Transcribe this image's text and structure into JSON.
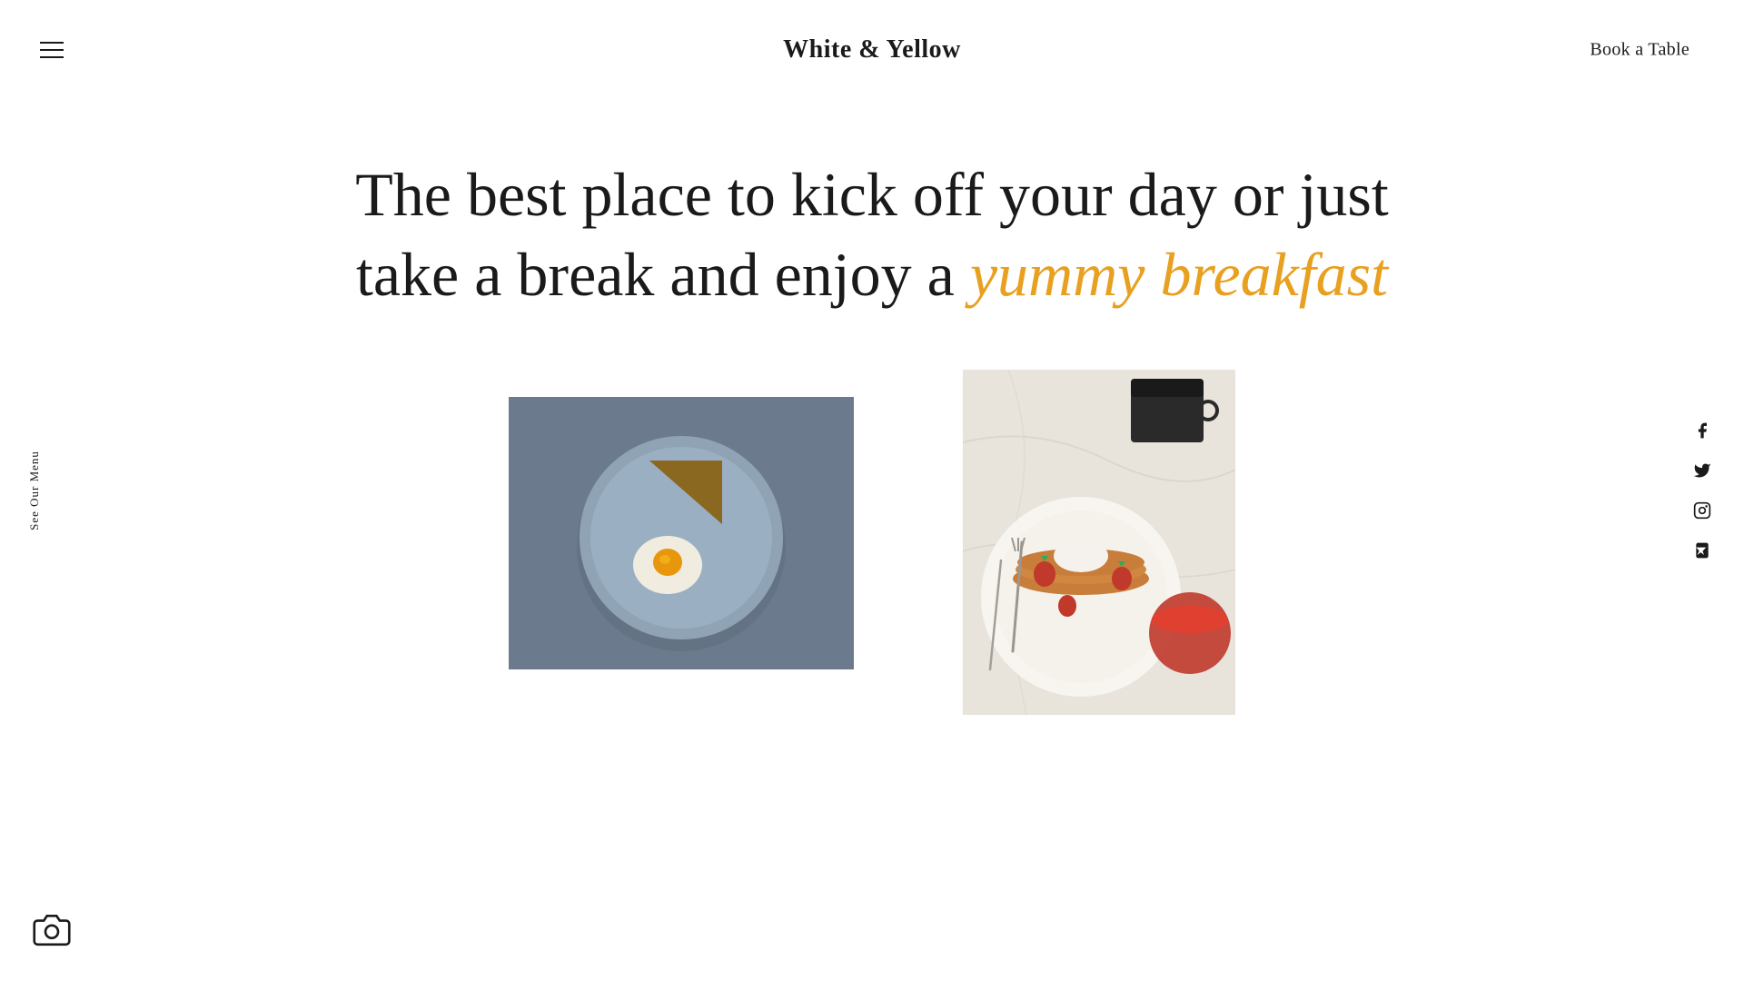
{
  "header": {
    "site_title": "White & Yellow",
    "book_table_label": "Book a Table"
  },
  "hero": {
    "line1": "The best place to kick off your day or just",
    "line2_normal": "take a break and enjoy a ",
    "line2_highlight": "yummy breakfast"
  },
  "sidebar": {
    "see_menu": "See Our Menu"
  },
  "social": {
    "facebook": "f",
    "twitter": "t",
    "instagram": "i",
    "foursquare": "4"
  },
  "images": {
    "image1_alt": "Fried egg and toast on a blue plate",
    "image2_alt": "Pancakes with strawberries and coffee"
  },
  "colors": {
    "accent": "#e8a020",
    "dark": "#1a1a1a",
    "white": "#ffffff"
  }
}
